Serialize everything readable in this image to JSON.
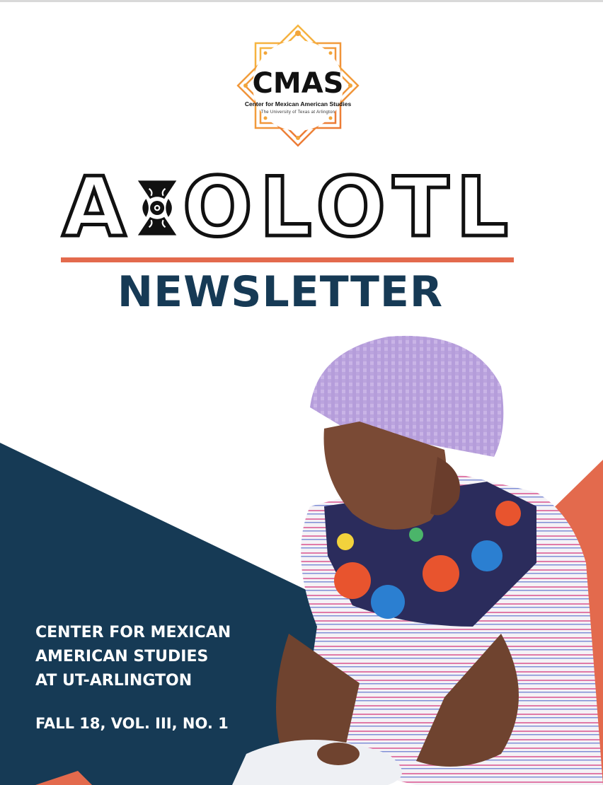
{
  "logo": {
    "main": "CMAS",
    "subtitle": "Center for Mexican American Studies",
    "university": "The University of Texas at Arlington"
  },
  "title": {
    "letters_before": "A",
    "letters_after": "OLOTL",
    "full_text": "AXOLOTL",
    "subtitle": "NEWSLETTER"
  },
  "info": {
    "org_lines": [
      "CENTER FOR MEXICAN",
      "AMERICAN STUDIES",
      "AT UT-ARLINGTON"
    ],
    "issue": "FALL 18, VOL. III, NO. 1"
  },
  "colors": {
    "navy": "#163a55",
    "orange": "#e36a4d",
    "gold": "#f2a53a"
  },
  "icons": {
    "logo_badge": "eight-point-star-badge-icon",
    "title_x": "decorative-x-glyph-icon"
  }
}
